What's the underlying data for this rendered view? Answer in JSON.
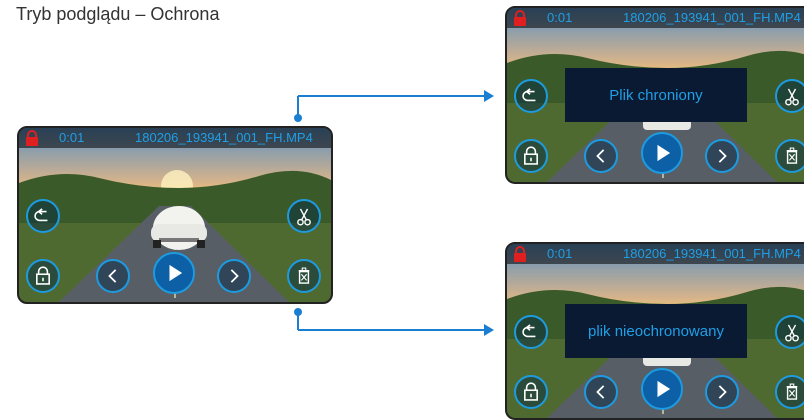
{
  "page": {
    "title": "Tryb podglądu – Ochrona"
  },
  "screens": {
    "main": {
      "time": "0:01",
      "filename": "180206_193941_001_FH.MP4"
    },
    "protected": {
      "time": "0:01",
      "filename": "180206_193941_001_FH.MP4",
      "message": "Plik chroniony"
    },
    "unprotected": {
      "time": "0:01",
      "filename": "180206_193941_001_FH.MP4",
      "message": "plik nieochronowany"
    }
  },
  "icons": {
    "lock": "lock-icon",
    "back": "back-icon",
    "cut": "scissors-icon",
    "protect": "padlock-icon",
    "prev": "chevron-left-icon",
    "play": "play-icon",
    "next": "chevron-right-icon",
    "delete": "trash-icon"
  },
  "colors": {
    "accent": "#1f9fe6",
    "lock": "#e02020",
    "message_bg": "#0b1a33",
    "connector": "#1a7fd0"
  }
}
